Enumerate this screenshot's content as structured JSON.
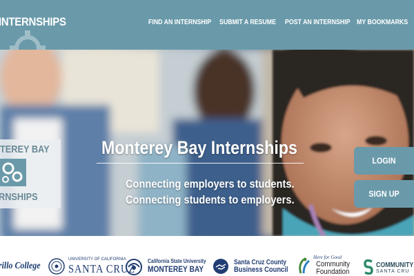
{
  "header": {
    "logo_text": "INTERNSHIPS",
    "nav": [
      {
        "label": "FIND AN INTERNSHIP"
      },
      {
        "label": "SUBMIT A RESUME"
      },
      {
        "label": "POST AN INTERNSHIP"
      },
      {
        "label": "MY BOOKMARKS"
      }
    ]
  },
  "hero": {
    "logo_top": "TEREY BAY",
    "logo_bottom": "RNSHIPS",
    "title": "Monterey Bay Internships",
    "subtitle_line1": "Connecting employers to students.",
    "subtitle_line2": "Connecting students to employers."
  },
  "actions": {
    "login_label": "LOGIN",
    "signup_label": "SIGN UP"
  },
  "partners": {
    "cabrillo": "rillo College",
    "ucsc_top": "UNIVERSITY OF CALIFORNIA",
    "ucsc_bottom": "SANTA CRUZ",
    "csumb_top": "California State University",
    "csumb_bottom": "MONTEREY BAY",
    "sccbc_top": "Santa Cruz County",
    "sccbc_bottom": "Business Council",
    "ccf_tag": "Here for Good",
    "ccf_line1": "Community",
    "ccf_line2": "Foundation",
    "cfsc_line1": "COMMUNITY F",
    "cfsc_line2": "SANTA CRU"
  },
  "colors": {
    "brand": "#6a9aaa",
    "partner_navy": "#213d72",
    "ccf_green": "#4a8a3a"
  }
}
